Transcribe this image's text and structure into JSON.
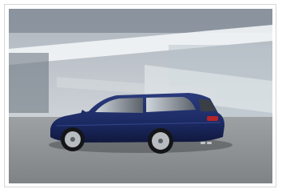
{
  "image": {
    "subject": "car-photo",
    "colors": {
      "car_body": "#1c2a63",
      "background_building": "#c9d0d6",
      "road": "#8f9396",
      "frame_border": "#d6d6d6"
    }
  }
}
